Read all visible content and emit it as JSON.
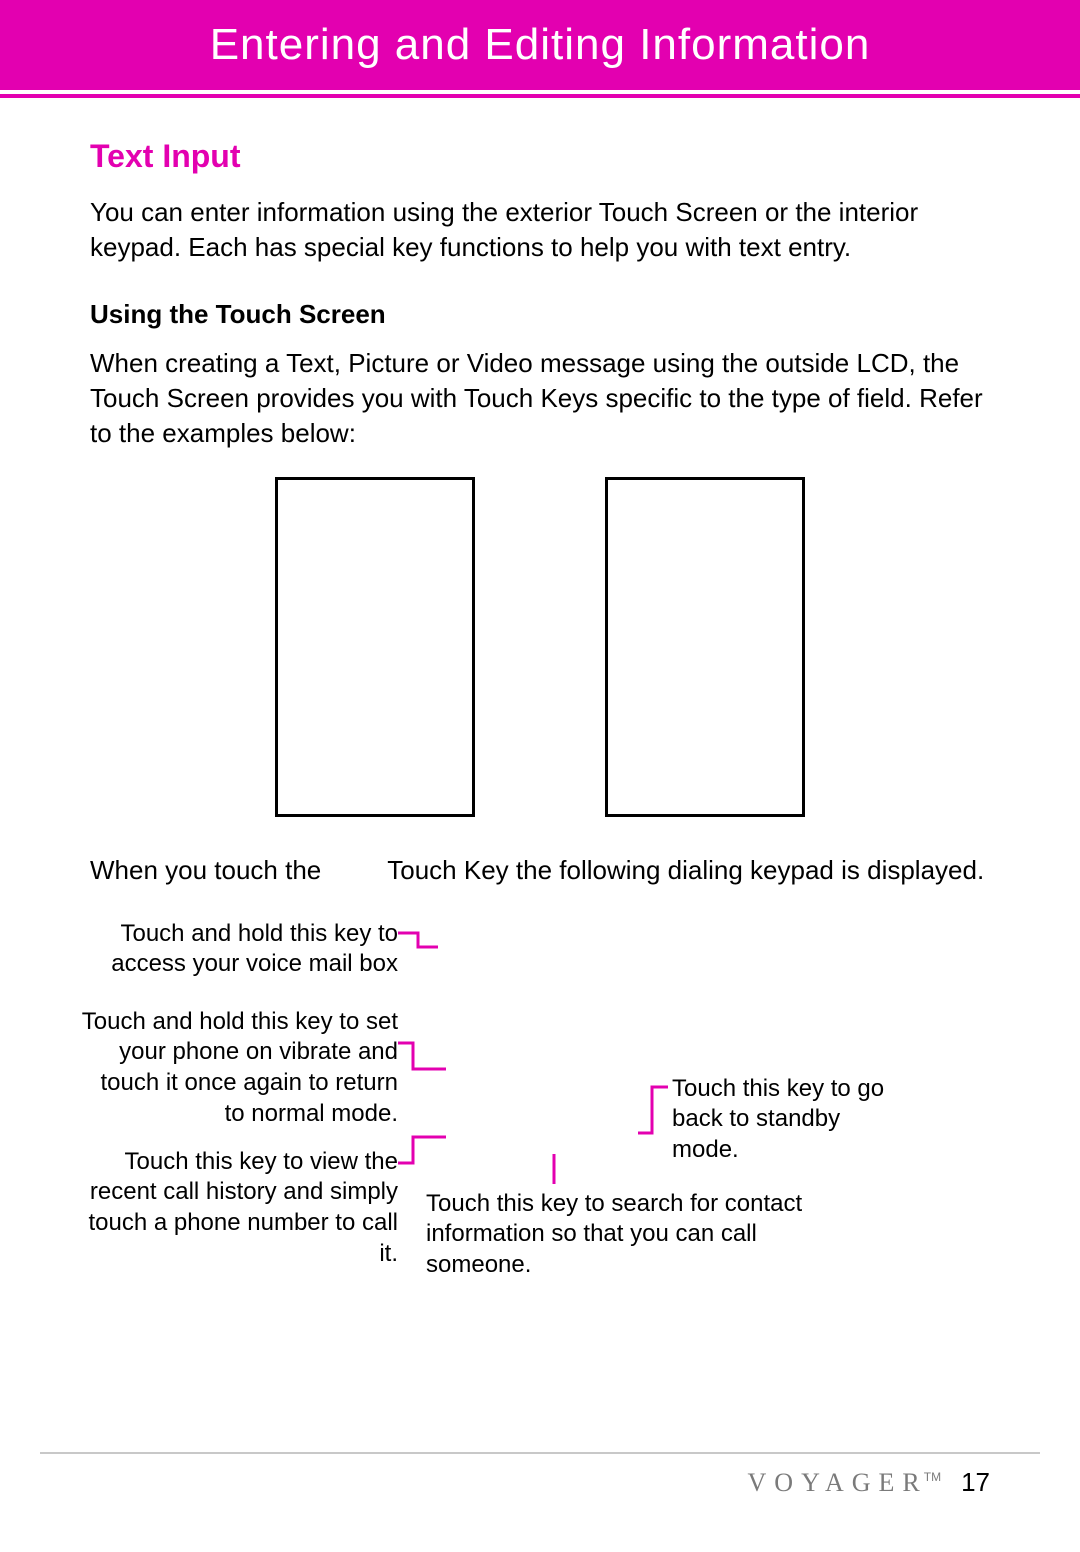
{
  "header": {
    "title": "Entering and Editing Information"
  },
  "section": {
    "title": "Text Input",
    "intro": "You can enter information using the exterior Touch Screen or the interior keypad. Each has special key functions to help you with text entry.",
    "sub_title": "Using the Touch Screen",
    "sub_intro": "When creating a Text, Picture or Video message using the outside LCD, the Touch Screen provides you with Touch Keys specific to the type of field. Refer to the examples below:",
    "touch_sentence_a": "When you touch the",
    "touch_sentence_b": "Touch Key the following dialing keypad is displayed."
  },
  "callouts": {
    "voicemail": "Touch and hold this key to access your voice mail box",
    "vibrate": "Touch and hold this key to set your phone on vibrate and touch it once again to return to normal mode.",
    "recent": "Touch this key to view the recent call history and simply touch a phone number to call it.",
    "standby": "Touch this key to go back to standby mode.",
    "search": "Touch this key to search for contact information so that you can call someone."
  },
  "footer": {
    "brand": "VOYAGER",
    "tm": "TM",
    "page": "17"
  }
}
